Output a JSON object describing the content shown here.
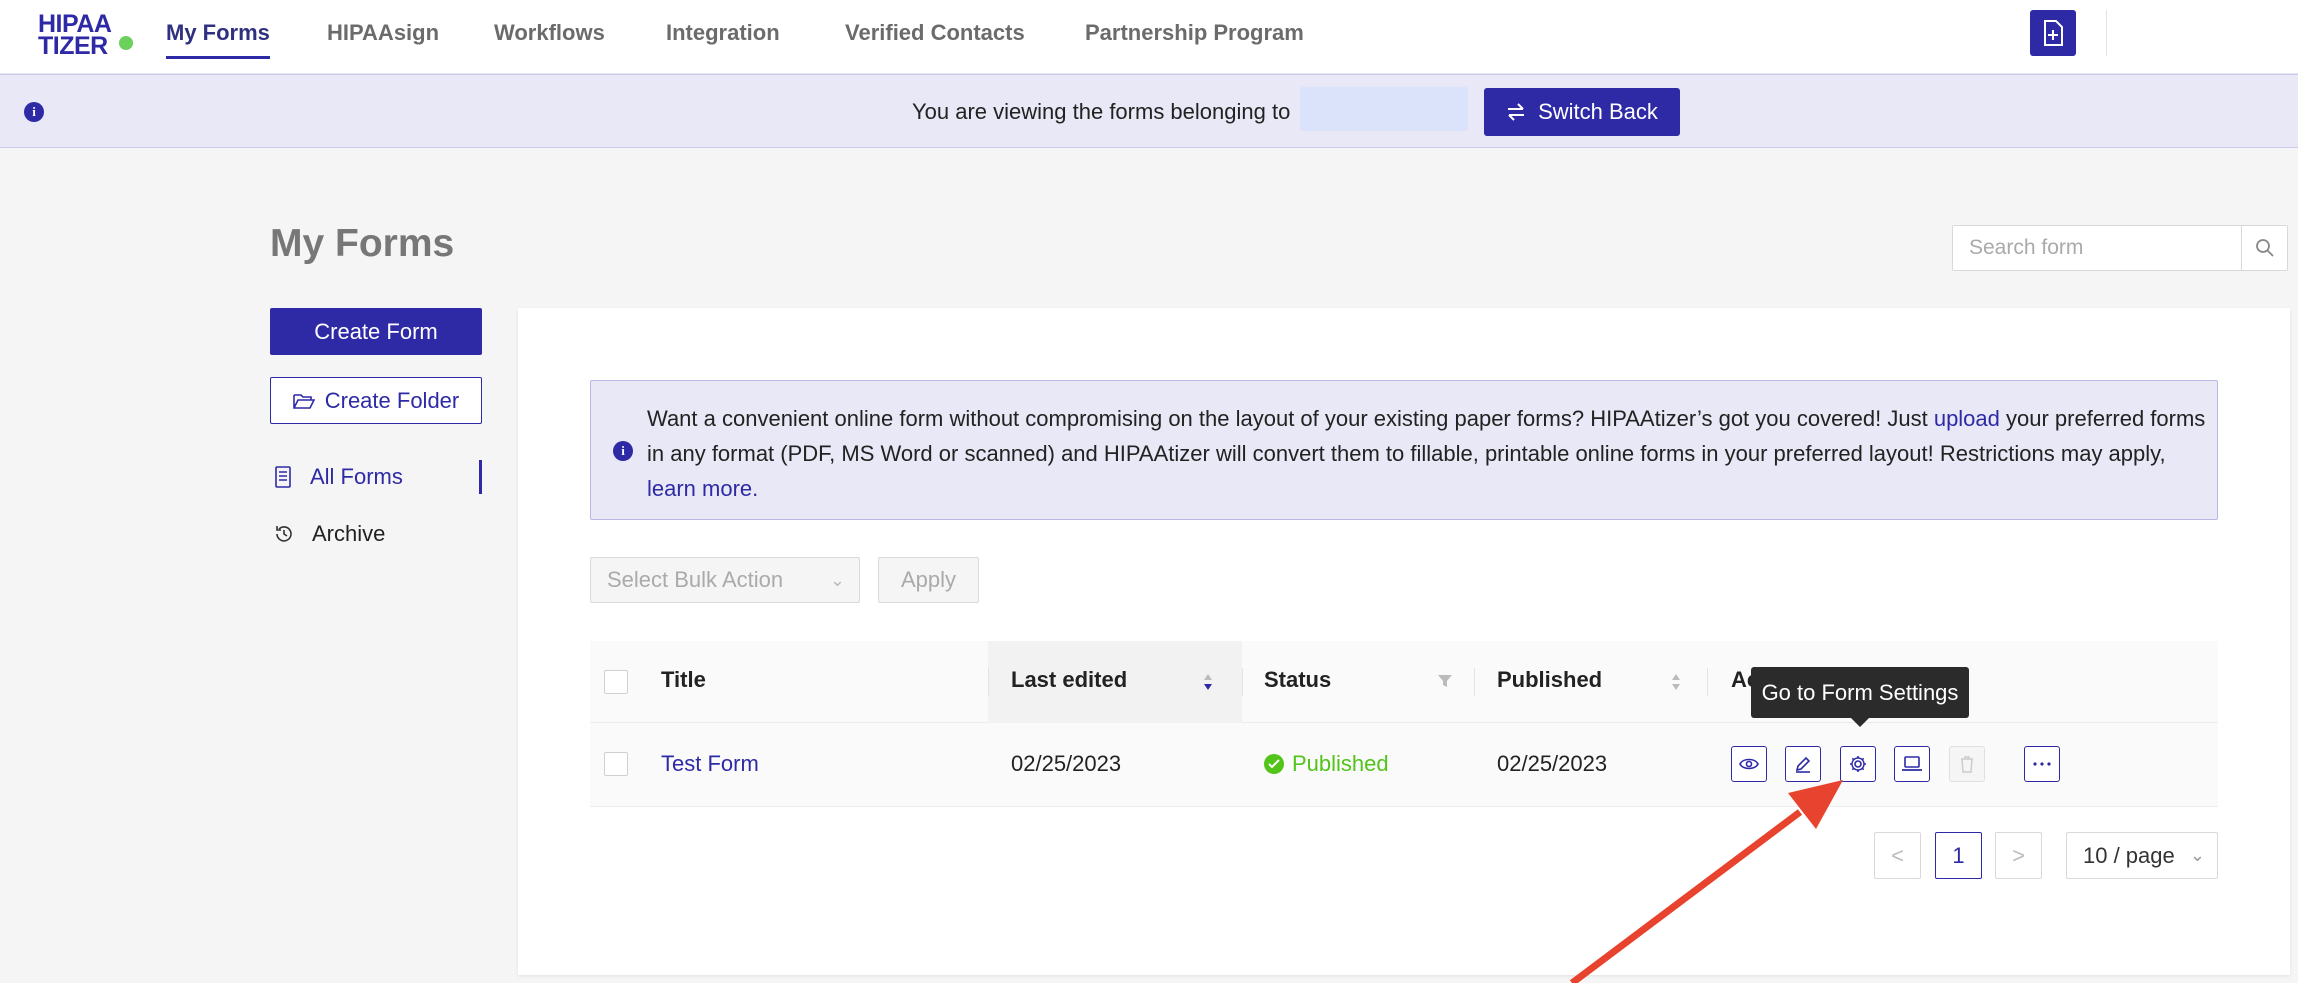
{
  "brand": {
    "logo_line1": "HIPAA",
    "logo_line2": "TIZER"
  },
  "nav": {
    "items": [
      {
        "label": "My Forms",
        "active": true
      },
      {
        "label": "HIPAAsign"
      },
      {
        "label": "Workflows"
      },
      {
        "label": "Integration"
      },
      {
        "label": "Verified Contacts"
      },
      {
        "label": "Partnership Program"
      }
    ],
    "new_form_icon": "file-plus-icon"
  },
  "banner": {
    "icon": "info-icon",
    "message": "You are viewing the forms belonging to",
    "switch_back_label": "Switch Back"
  },
  "page": {
    "title": "My Forms"
  },
  "search": {
    "placeholder": "Search form",
    "value": ""
  },
  "sidebar": {
    "create_form_label": "Create Form",
    "create_folder_label": "Create Folder",
    "items": [
      {
        "label": "All Forms",
        "icon": "form-list-icon",
        "active": true
      },
      {
        "label": "Archive",
        "icon": "clock-history-icon"
      }
    ]
  },
  "notice": {
    "part1": "Want a convenient online form without compromising on the layout of your existing paper forms? HIPAAtizer’s got you covered! Just ",
    "link1": "upload",
    "part2": " your preferred forms in any format (PDF, MS Word or scanned) and HIPAAtizer will convert them to fillable, printable online forms in your preferred layout! Restrictions may apply, ",
    "link2": "learn more."
  },
  "bulk": {
    "placeholder": "Select Bulk Action",
    "apply_label": "Apply"
  },
  "table": {
    "columns": {
      "title": "Title",
      "last_edited": "Last edited",
      "status": "Status",
      "published": "Published",
      "actions": "Actions"
    },
    "rows": [
      {
        "title": "Test Form",
        "last_edited": "02/25/2023",
        "status": "Published",
        "published": "02/25/2023"
      }
    ]
  },
  "tooltip": {
    "text": "Go to Form Settings"
  },
  "pagination": {
    "prev": "<",
    "current": "1",
    "next": ">",
    "page_size": "10 / page"
  },
  "colors": {
    "primary": "#2e2aa6",
    "success": "#52c41a",
    "annotation_arrow": "#e8432e",
    "banner_bg": "#e8e8f6"
  }
}
